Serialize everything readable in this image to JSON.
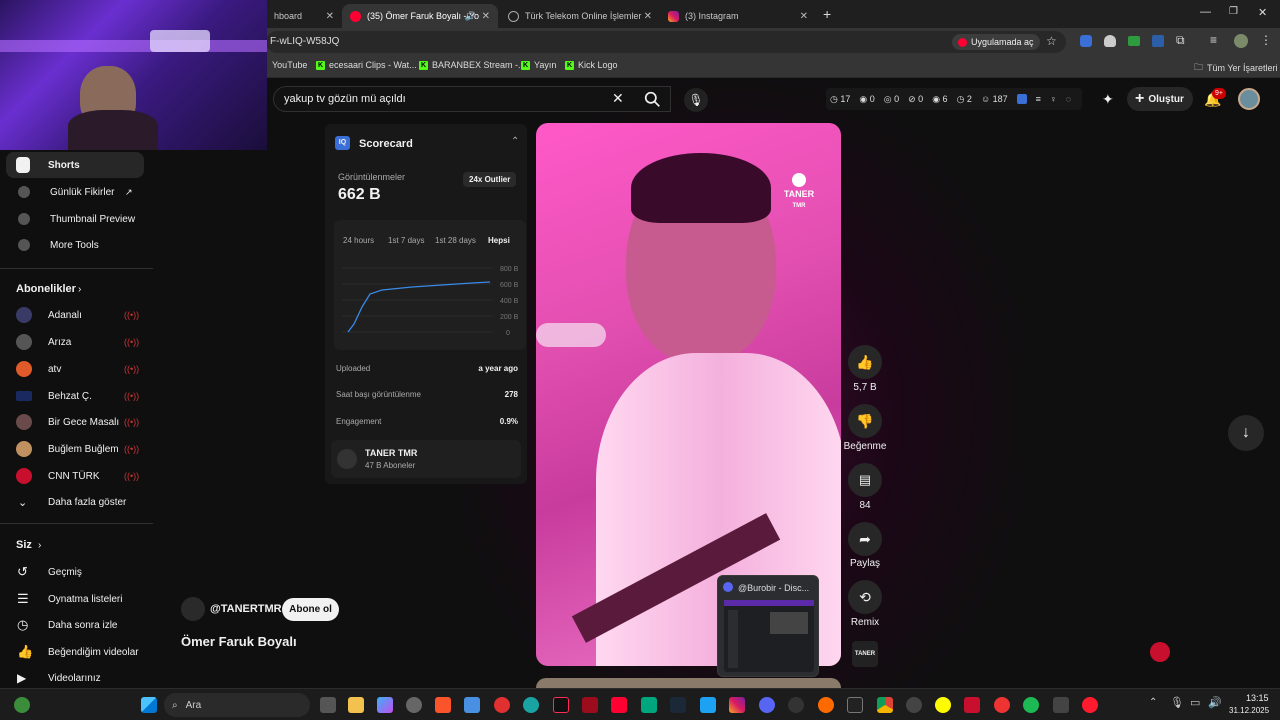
{
  "browser": {
    "tabs": [
      {
        "label": "hboard"
      },
      {
        "label": "(35) Ömer Faruk Boyalı - Yo"
      },
      {
        "label": "Türk Telekom Online İşlemler"
      },
      {
        "label": "(3) Instagram"
      }
    ],
    "url": "F-wLIQ-W58JQ",
    "open_in_app": "Uygulamada aç",
    "bookmarks": [
      "YouTube",
      "ecesaari Clips - Wat...",
      "BARANBEX Stream -...",
      "Yayın",
      "Kick Logo"
    ],
    "all_bookmarks": "Tüm Yer İşaretleri"
  },
  "header": {
    "search_value": "yakup tv gözün mü açıldı",
    "stats": [
      "17",
      "0",
      "0",
      "0",
      "6",
      "2",
      "187"
    ],
    "create_label": "Oluştur",
    "notif_badge": "9+"
  },
  "sidebar": {
    "top_items": [
      {
        "label": "Shorts"
      },
      {
        "label": "Günlük Fikirler"
      },
      {
        "label": "Thumbnail Preview"
      },
      {
        "label": "More Tools"
      }
    ],
    "subs_title": "Abonelikler",
    "subs": [
      {
        "label": "Adanalı",
        "color": "#3a3a66"
      },
      {
        "label": "Arıza",
        "color": "#555555"
      },
      {
        "label": "atv",
        "color": "#e05a2a"
      },
      {
        "label": "Behzat Ç.",
        "color": "#1a2a60"
      },
      {
        "label": "Bir Gece Masalı",
        "color": "#6a4a4a"
      },
      {
        "label": "Buğlem Buğlem",
        "color": "#c09060"
      },
      {
        "label": "CNN TÜRK",
        "color": "#c8102e"
      }
    ],
    "show_more": "Daha fazla göster",
    "you_title": "Siz",
    "you_items": [
      {
        "label": "Geçmiş"
      },
      {
        "label": "Oynatma listeleri"
      },
      {
        "label": "Daha sonra izle"
      },
      {
        "label": "Beğendiğim videolar"
      },
      {
        "label": "Videolarınız"
      }
    ]
  },
  "scorecard": {
    "title": "Scorecard",
    "views_label": "Görüntülenmeler",
    "views_value": "662 B",
    "outlier": "24x Outlier",
    "ranges": [
      "24 hours",
      "1st 7 days",
      "1st 28 days",
      "Hepsi"
    ],
    "y_ticks": [
      "800 B",
      "600 B",
      "400 B",
      "200 B",
      "0"
    ],
    "uploaded_label": "Uploaded",
    "uploaded_value": "a year ago",
    "hourly_label": "Saat başı görüntülenme",
    "hourly_value": "278",
    "engagement_label": "Engagement",
    "engagement_value": "0.9%",
    "channel_name": "TANER TMR",
    "channel_subs": "47 B Aboneler"
  },
  "short": {
    "watermark": "TANER",
    "watermark_sub": "TMR",
    "channel_handle": "@TANERTMR",
    "subscribe": "Abone ol",
    "title": "Ömer Faruk Boyalı",
    "likes": "5,7 B",
    "dislike": "Beğenme",
    "comments": "84",
    "share": "Paylaş",
    "remix": "Remix",
    "avatar_text": "TANER"
  },
  "popup": {
    "title": "@Burobir - Disc..."
  },
  "taskbar": {
    "search": "Ara",
    "time": "13:15",
    "date": "31.12.2025"
  },
  "colors": {
    "accent_red": "#ff0033",
    "kick_green": "#53fc18"
  }
}
